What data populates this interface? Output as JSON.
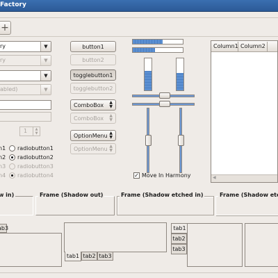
{
  "window": {
    "title": "Factory"
  },
  "toolbar": {
    "add_icon": "+"
  },
  "left": {
    "combo1": "ry",
    "combo2": "ry",
    "combo4": "abled)",
    "spin_value": "1",
    "radio": [
      "radiobutton1",
      "radiobutton2",
      "radiobutton3",
      "radiobutton4"
    ],
    "radio_left": [
      "n1",
      "n2",
      "n3",
      "n4"
    ]
  },
  "buttons": {
    "button1": "button1",
    "button2": "button2",
    "toggle1": "togglebutton1",
    "toggle2": "togglebutton2",
    "combo1": "ComboBox",
    "combo2": "ComboBox",
    "option1": "OptionMenu",
    "option2": "OptionMenu"
  },
  "progress": {
    "hbar1": 0.6,
    "hbar2": 0.45,
    "vbar1": 0.6,
    "vbar2": 0.55
  },
  "sliders": {
    "h1": 0.5,
    "h2": 0.5,
    "v1": 0.5,
    "v2": 0.5
  },
  "harmony": {
    "label": "Move In Harmony",
    "checked": true
  },
  "tree": {
    "columns": [
      "Column1",
      "Column2"
    ]
  },
  "frames": [
    "w in)",
    "Frame (Shadow out)",
    "Frame (Shadow etched in)",
    "Frame (Shadow etch"
  ],
  "notebooks": {
    "left_tab": "tab3",
    "bottom_tabs": [
      "tab1",
      "tab2",
      "tab3"
    ],
    "side_tabs": [
      "tab1",
      "tab2",
      "tab3"
    ]
  }
}
